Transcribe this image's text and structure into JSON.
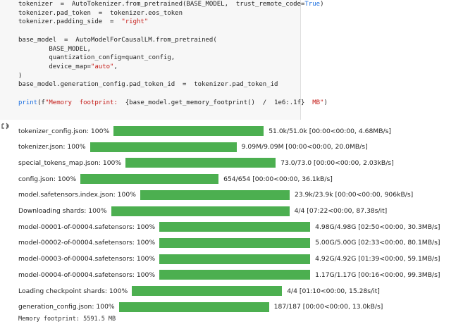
{
  "code_lines": [
    [
      {
        "t": "tokenizer  =  AutoTokenizer.from_pretrained(BASE_MODEL,  trust_remote_code="
      },
      {
        "t": "True",
        "c": "kw"
      },
      {
        "t": ")"
      }
    ],
    [
      {
        "t": "tokenizer.pad_token  =  tokenizer.eos_token"
      }
    ],
    [
      {
        "t": "tokenizer.padding_side  =  "
      },
      {
        "t": "\"right\"",
        "c": "str"
      }
    ],
    [
      {
        "t": ""
      }
    ],
    [
      {
        "t": "base_model  =  AutoModelForCausalLM.from_pretrained("
      }
    ],
    [
      {
        "t": "        BASE_MODEL,"
      }
    ],
    [
      {
        "t": "        quantization_config=quant_config,"
      }
    ],
    [
      {
        "t": "        device_map="
      },
      {
        "t": "\"auto\"",
        "c": "str"
      },
      {
        "t": ","
      }
    ],
    [
      {
        "t": ")"
      }
    ],
    [
      {
        "t": "base_model.generation_config.pad_token_id  =  tokenizer.pad_token_id"
      }
    ],
    [
      {
        "t": ""
      }
    ],
    [
      {
        "t": "print",
        "c": "kw"
      },
      {
        "t": "(f"
      },
      {
        "t": "\"Memory  footprint:  ",
        "c": "str"
      },
      {
        "t": "{base_model.get_memory_footprint()  /  1e6:.1f}"
      },
      {
        "t": "  MB\"",
        "c": "str"
      },
      {
        "t": ")"
      }
    ]
  ],
  "progress_rows": [
    {
      "label": "tokenizer_config.json: 100%",
      "stats": "51.0k/51.0k [00:00<00:00, 4.68MB/s]",
      "progress": 1.0
    },
    {
      "label": "tokenizer.json: 100%",
      "stats": "9.09M/9.09M [00:00<00:00, 20.0MB/s]",
      "progress": 1.0
    },
    {
      "label": "special_tokens_map.json: 100%",
      "stats": "73.0/73.0 [00:00<00:00, 2.03kB/s]",
      "progress": 1.0
    },
    {
      "label": "config.json: 100%",
      "stats": "654/654 [00:00<00:00, 36.1kB/s]",
      "progress": 1.0
    },
    {
      "label": "model.safetensors.index.json: 100%",
      "stats": "23.9k/23.9k [00:00<00:00, 906kB/s]",
      "progress": 1.0
    },
    {
      "label": "Downloading shards: 100%",
      "stats": "4/4 [07:22<00:00, 87.38s/it]",
      "progress": 1.0
    },
    {
      "label": "model-00001-of-00004.safetensors: 100%",
      "stats": "4.98G/4.98G [02:50<00:00, 30.3MB/s]",
      "progress": 1.0
    },
    {
      "label": "model-00002-of-00004.safetensors: 100%",
      "stats": "5.00G/5.00G [02:33<00:00, 80.1MB/s]",
      "progress": 1.0
    },
    {
      "label": "model-00003-of-00004.safetensors: 100%",
      "stats": "4.92G/4.92G [01:39<00:00, 59.1MB/s]",
      "progress": 1.0
    },
    {
      "label": "model-00004-of-00004.safetensors: 100%",
      "stats": "1.17G/1.17G [00:16<00:00, 99.3MB/s]",
      "progress": 1.0
    },
    {
      "label": "Loading checkpoint shards: 100%",
      "stats": "4/4 [01:10<00:00, 15.28s/it]",
      "progress": 1.0
    },
    {
      "label": "generation_config.json: 100%",
      "stats": "187/187 [00:00<00:00, 13.0kB/s]",
      "progress": 1.0
    }
  ],
  "output_text": "Memory footprint: 5591.5 MB",
  "colors": {
    "bar": "#4caf50",
    "keyword": "#1a6ee0",
    "string": "#c41a16",
    "cell_bg": "#f7f7f7"
  },
  "icons": {
    "output_toggle": "output-toggle-icon"
  }
}
